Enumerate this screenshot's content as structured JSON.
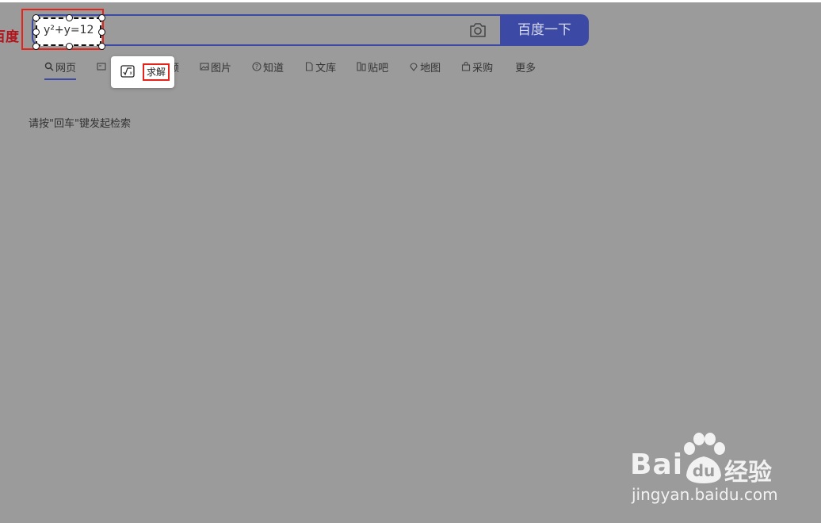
{
  "logo_text": "百度",
  "search": {
    "query": "y²+y=12",
    "button_label": "百度一下"
  },
  "tabs": [
    {
      "label": "网页",
      "icon": "search-icon"
    },
    {
      "label": "视频",
      "icon": "video-icon"
    },
    {
      "label": "图片",
      "icon": "image-icon"
    },
    {
      "label": "知道",
      "icon": "question-icon"
    },
    {
      "label": "文库",
      "icon": "document-icon"
    },
    {
      "label": "贴吧",
      "icon": "tieba-icon"
    },
    {
      "label": "地图",
      "icon": "map-pin-icon"
    },
    {
      "label": "采购",
      "icon": "shopping-icon"
    },
    {
      "label": "更多",
      "icon": ""
    }
  ],
  "popup": {
    "solve_label": "求解",
    "icon": "formula-icon"
  },
  "hint": "请按\"回车\"键发起检索",
  "watermark": {
    "brand": "Bai  u",
    "du": "du",
    "jingyan": "经验",
    "url": "jingyan.baidu.com"
  },
  "colors": {
    "accent": "#3c4aa5",
    "highlight": "#e5231b",
    "overlay": "#9b9b9b"
  }
}
